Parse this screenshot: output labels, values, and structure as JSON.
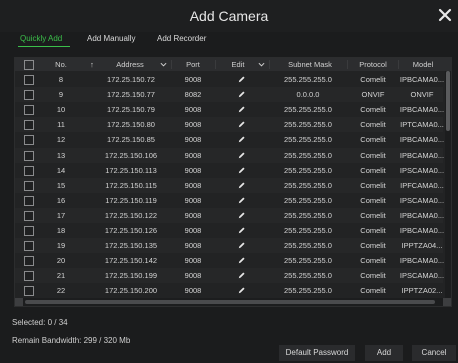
{
  "dialog": {
    "title": "Add Camera"
  },
  "tabs": [
    {
      "label": "Quickly Add",
      "active": true
    },
    {
      "label": "Add Manually",
      "active": false
    },
    {
      "label": "Add Recorder",
      "active": false
    }
  ],
  "table": {
    "columns": [
      "No.",
      "Address",
      "Port",
      "Edit",
      "Subnet Mask",
      "Protocol",
      "Model"
    ],
    "rows": [
      {
        "no": "8",
        "address": "172.25.150.72",
        "port": "9008",
        "mask": "255.255.255.0",
        "protocol": "Comelit",
        "model": "IPBCAMA0..."
      },
      {
        "no": "9",
        "address": "172.25.150.77",
        "port": "8082",
        "mask": "0.0.0.0",
        "protocol": "ONVIF",
        "model": "ONVIF"
      },
      {
        "no": "10",
        "address": "172.25.150.79",
        "port": "9008",
        "mask": "255.255.255.0",
        "protocol": "Comelit",
        "model": "IPBCAMA0..."
      },
      {
        "no": "11",
        "address": "172.25.150.80",
        "port": "9008",
        "mask": "255.255.255.0",
        "protocol": "Comelit",
        "model": "IPTCAMA0..."
      },
      {
        "no": "12",
        "address": "172.25.150.85",
        "port": "9008",
        "mask": "255.255.255.0",
        "protocol": "Comelit",
        "model": "IPBCAMA0..."
      },
      {
        "no": "13",
        "address": "172.25.150.106",
        "port": "9008",
        "mask": "255.255.255.0",
        "protocol": "Comelit",
        "model": "IPBCAMA0..."
      },
      {
        "no": "14",
        "address": "172.25.150.113",
        "port": "9008",
        "mask": "255.255.255.0",
        "protocol": "Comelit",
        "model": "IPSCAMA0..."
      },
      {
        "no": "15",
        "address": "172.25.150.115",
        "port": "9008",
        "mask": "255.255.255.0",
        "protocol": "Comelit",
        "model": "IPFCAMA0..."
      },
      {
        "no": "16",
        "address": "172.25.150.119",
        "port": "9008",
        "mask": "255.255.255.0",
        "protocol": "Comelit",
        "model": "IPSCAMA0..."
      },
      {
        "no": "17",
        "address": "172.25.150.122",
        "port": "9008",
        "mask": "255.255.255.0",
        "protocol": "Comelit",
        "model": "IPBCAMA0..."
      },
      {
        "no": "18",
        "address": "172.25.150.126",
        "port": "9008",
        "mask": "255.255.255.0",
        "protocol": "Comelit",
        "model": "IPBCAMA0..."
      },
      {
        "no": "19",
        "address": "172.25.150.135",
        "port": "9008",
        "mask": "255.255.255.0",
        "protocol": "Comelit",
        "model": "IPPTZA04..."
      },
      {
        "no": "20",
        "address": "172.25.150.142",
        "port": "9008",
        "mask": "255.255.255.0",
        "protocol": "Comelit",
        "model": "IPBCAMA0..."
      },
      {
        "no": "21",
        "address": "172.25.150.199",
        "port": "9008",
        "mask": "255.255.255.0",
        "protocol": "Comelit",
        "model": "IPSCAMA0..."
      },
      {
        "no": "22",
        "address": "172.25.150.200",
        "port": "9008",
        "mask": "255.255.255.0",
        "protocol": "Comelit",
        "model": "IPPTZA02..."
      }
    ]
  },
  "status": {
    "selected": "Selected: 0 / 34",
    "bandwidth": "Remain Bandwidth: 299 / 320 Mb"
  },
  "buttons": {
    "default_password": "Default Password",
    "add": "Add",
    "cancel": "Cancel"
  },
  "colors": {
    "accent": "#3bbf4a",
    "background": "#1b1c1d"
  }
}
